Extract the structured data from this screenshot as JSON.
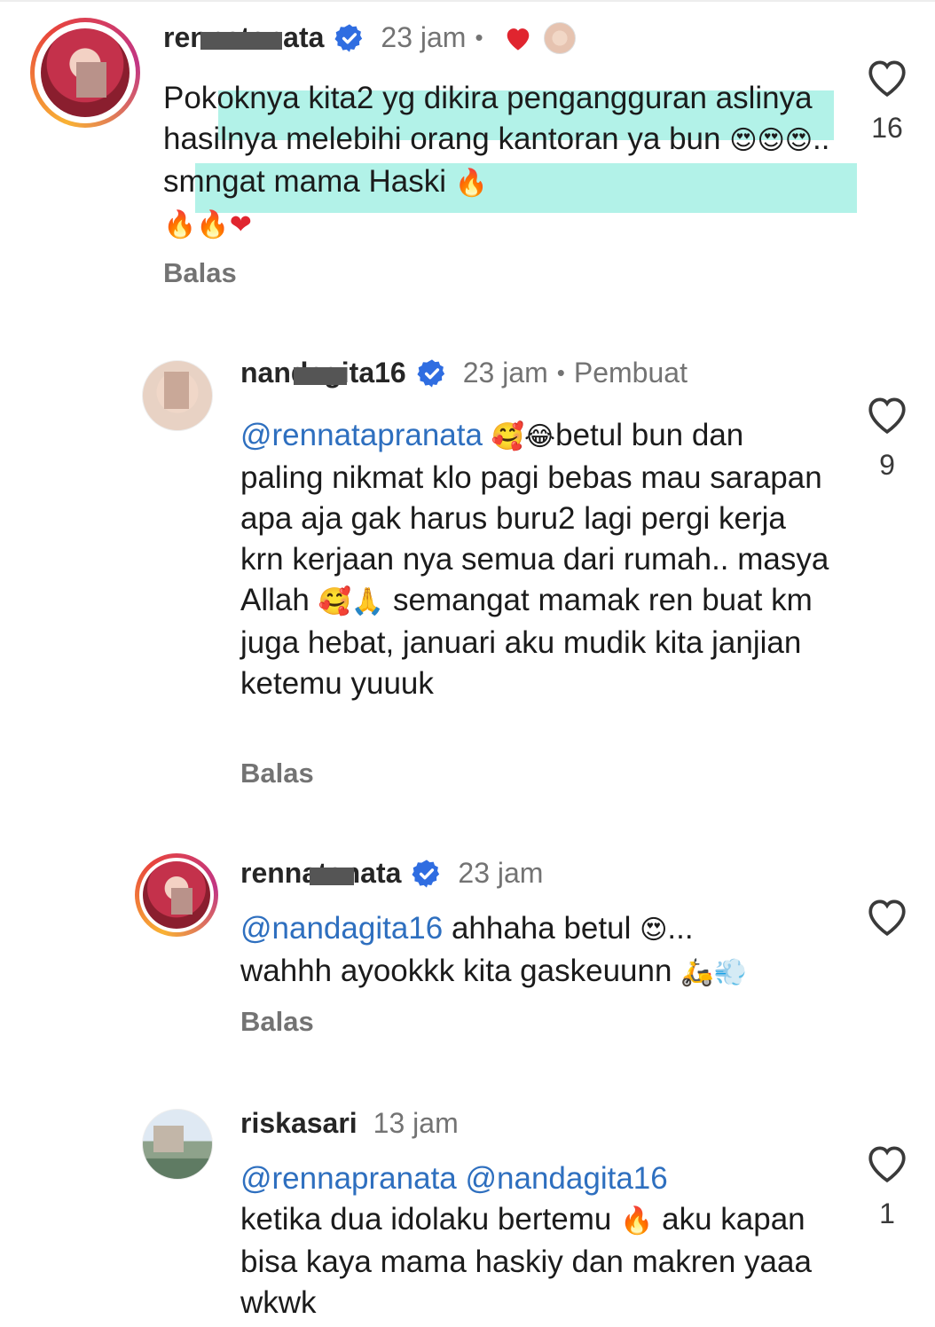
{
  "colors": {
    "mention": "#2e6fbf",
    "verified": "#2f6de1",
    "muted": "#737373",
    "highlight": "#72e8d5",
    "heart_red": "#e0252f"
  },
  "comments": [
    {
      "username": "rennatanata",
      "time": "23 jam",
      "text_before_highlight": "Pok",
      "text_main": "oknya kita2 yg dikira pengangguran aslinya hasilnya melebihi orang kantoran ya bun",
      "text_after": ".. smngat mama Haski",
      "reply_label": "Balas",
      "like_count": "16"
    },
    {
      "username": "nandagita16",
      "time": "23 jam",
      "author_tag": "Pembuat",
      "mention": "@rennatapranata",
      "text_1": "betul bun dan paling nikmat klo pagi bebas mau sarapan apa aja gak harus buru2 lagi pergi kerja krn kerjaan nya semua dari rumah.. masya Allah",
      "text_2": "semangat mamak ren buat km juga hebat, januari aku mudik kita janjian ketemu yuuuk",
      "reply_label": "Balas",
      "like_count": "9"
    },
    {
      "username": "rennatanata",
      "time": "23 jam",
      "mention": "@nandagita16",
      "text_1": " ahhaha betul",
      "text_2": "...",
      "text_3": "wahhh ayookkk kita gaskeuunn",
      "reply_label": "Balas"
    },
    {
      "username": "riskasari",
      "time": "13 jam",
      "mention_1": "@rennapranata",
      "mention_2": "@nandagita16",
      "text_1": "ketika dua idolaku bertemu",
      "text_2": " aku kapan bisa kaya mama haskiy dan makren yaaa wkwk",
      "like_count": "1"
    }
  ],
  "icons": {
    "heart": "heart-outline-icon",
    "verified": "verified-badge-icon",
    "fire": "fire-emoji",
    "red_heart": "red-heart-emoji"
  }
}
